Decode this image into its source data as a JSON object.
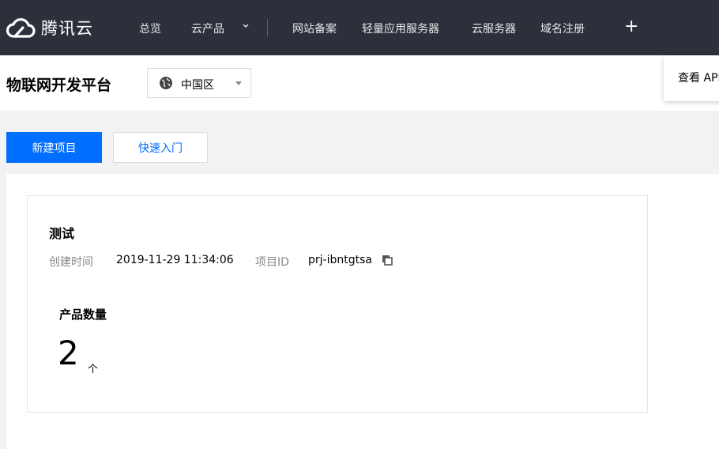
{
  "topnav": {
    "brand": "腾讯云",
    "items": [
      "总览",
      "云产品",
      "网站备案",
      "轻量应用服务器",
      "云服务器",
      "域名注册"
    ],
    "plus": "+"
  },
  "subhead": {
    "title": "物联网开发平台",
    "region": "中国区",
    "api_text": "查看 API"
  },
  "toolbar": {
    "new_project": "新建项目",
    "quick_start": "快速入门"
  },
  "project": {
    "name": "测试",
    "created_label": "创建时间",
    "created_value": "2019-11-29 11:34:06",
    "id_label": "项目ID",
    "id_value": "prj-ibntgtsa",
    "product_count_label": "产品数量",
    "product_count": "2",
    "product_count_unit": "个"
  },
  "colors": {
    "nav_bg": "#2b303b",
    "primary": "#006eff"
  }
}
